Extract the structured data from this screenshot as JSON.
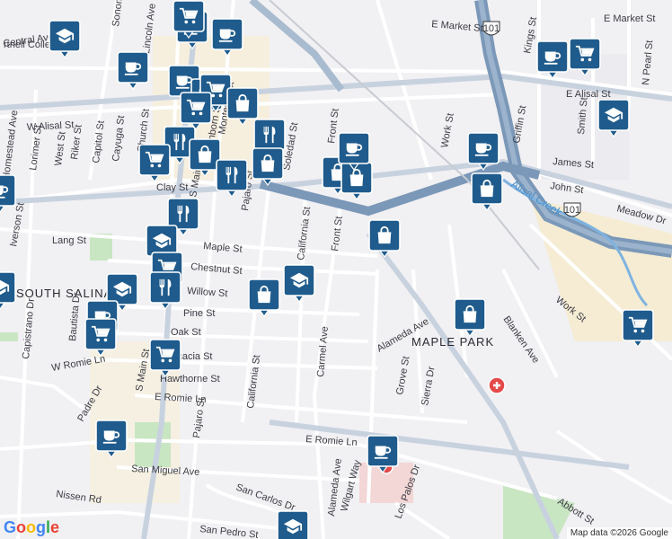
{
  "map": {
    "attribution": "Map data ©2026 Google",
    "logo": "Google",
    "area_labels": [
      {
        "id": "maple-park",
        "text": "MAPLE PARK"
      },
      {
        "id": "south-salinas",
        "text": "SOUTH SALINA"
      },
      {
        "id": "hartnell",
        "text": "rtnell College"
      }
    ],
    "water_labels": [
      {
        "id": "alisal-creek",
        "text": "Alisal Creek"
      }
    ],
    "route_shields": [
      {
        "id": "us101-a",
        "text": "101"
      },
      {
        "id": "us101-b",
        "text": "101"
      }
    ],
    "street_labels": [
      {
        "id": "e-market",
        "text": "E Market St"
      },
      {
        "id": "e-market-2",
        "text": "E Market St"
      },
      {
        "id": "e-alisal",
        "text": "E Alisal St"
      },
      {
        "id": "w-alisal",
        "text": "W Alisal St"
      },
      {
        "id": "central",
        "text": "Central Ave"
      },
      {
        "id": "kings",
        "text": "Kings St"
      },
      {
        "id": "n-pearl",
        "text": "N Pearl St"
      },
      {
        "id": "work-1",
        "text": "Work St"
      },
      {
        "id": "work-2",
        "text": "Work St"
      },
      {
        "id": "griffin",
        "text": "Griffin St"
      },
      {
        "id": "smith",
        "text": "Smith St"
      },
      {
        "id": "james",
        "text": "James St"
      },
      {
        "id": "john",
        "text": "John St"
      },
      {
        "id": "meadow",
        "text": "Meadow Dr"
      },
      {
        "id": "front-1",
        "text": "Front St"
      },
      {
        "id": "front-2",
        "text": "Front St"
      },
      {
        "id": "clay",
        "text": "Clay St"
      },
      {
        "id": "lang",
        "text": "Lang St"
      },
      {
        "id": "iverson",
        "text": "Iverson St"
      },
      {
        "id": "maple",
        "text": "Maple St"
      },
      {
        "id": "chestnut",
        "text": "Chestnut St"
      },
      {
        "id": "willow",
        "text": "Willow St"
      },
      {
        "id": "pine",
        "text": "Pine St"
      },
      {
        "id": "oak",
        "text": "Oak St"
      },
      {
        "id": "acacia",
        "text": "Acacia St"
      },
      {
        "id": "hawthorne",
        "text": "Hawthorne St"
      },
      {
        "id": "e-romie",
        "text": "E Romie Ln"
      },
      {
        "id": "e-romie-2",
        "text": "E Romie Ln"
      },
      {
        "id": "w-romie",
        "text": "W Romie Ln"
      },
      {
        "id": "pajaro-1",
        "text": "Pajaro St"
      },
      {
        "id": "pajaro-2",
        "text": "Pajaro St"
      },
      {
        "id": "california-1",
        "text": "California St"
      },
      {
        "id": "california-2",
        "text": "California St"
      },
      {
        "id": "carmel",
        "text": "Carmel Ave"
      },
      {
        "id": "alameda-1",
        "text": "Alameda Ave"
      },
      {
        "id": "alameda-2",
        "text": "Alameda Ave"
      },
      {
        "id": "grove",
        "text": "Grove St"
      },
      {
        "id": "sierra",
        "text": "Sierra Dr"
      },
      {
        "id": "hawthorne-s",
        "text": "S Main St"
      },
      {
        "id": "abbott",
        "text": "Abbott St"
      },
      {
        "id": "los-palos",
        "text": "Los Palos Dr"
      },
      {
        "id": "wilgart",
        "text": "Wilgart Way"
      },
      {
        "id": "san-miguel",
        "text": "San Miguel Ave"
      },
      {
        "id": "san-carlos",
        "text": "San Carlos Dr"
      },
      {
        "id": "san-pedro",
        "text": "San Pedro St"
      },
      {
        "id": "nissen",
        "text": "Nissen Rd"
      },
      {
        "id": "padre",
        "text": "Padre Dr"
      },
      {
        "id": "capistrano",
        "text": "Capistrano Dr"
      },
      {
        "id": "bautista",
        "text": "Bautista Dr"
      },
      {
        "id": "homestead",
        "text": "Homestead Ave"
      },
      {
        "id": "lorimer",
        "text": "Lorimer St"
      },
      {
        "id": "west",
        "text": "West St"
      },
      {
        "id": "riker",
        "text": "Riker St"
      },
      {
        "id": "capitol",
        "text": "Capitol St"
      },
      {
        "id": "cayuga",
        "text": "Cayuga St"
      },
      {
        "id": "church",
        "text": "Church St"
      },
      {
        "id": "lincoln",
        "text": "Lincoln Ave"
      },
      {
        "id": "soledad",
        "text": "Soledad St"
      },
      {
        "id": "monterey",
        "text": "Monterey St"
      },
      {
        "id": "sanborn",
        "text": "Sanborn St"
      },
      {
        "id": "main-s",
        "text": "S Main St"
      },
      {
        "id": "blanken",
        "text": "Blanken Ave"
      },
      {
        "id": "soledad-top",
        "text": "Sonoma"
      }
    ],
    "pins": [
      {
        "id": "p1",
        "icon": "school-icon"
      },
      {
        "id": "p2",
        "icon": "cafe-icon"
      },
      {
        "id": "p3",
        "icon": "shopping-cart-icon"
      },
      {
        "id": "p4",
        "icon": "cafe-icon"
      },
      {
        "id": "p5",
        "icon": "cafe-icon"
      },
      {
        "id": "p6",
        "icon": "cafe-icon"
      },
      {
        "id": "p7",
        "icon": "cafe-icon"
      },
      {
        "id": "p8",
        "icon": "shopping-cart-icon"
      },
      {
        "id": "p9",
        "icon": "shopping-bag-icon"
      },
      {
        "id": "p10",
        "icon": "restaurant-icon"
      },
      {
        "id": "p11",
        "icon": "shopping-cart-icon"
      },
      {
        "id": "p12",
        "icon": "shopping-bag-icon"
      },
      {
        "id": "p13",
        "icon": "restaurant-icon"
      },
      {
        "id": "p14",
        "icon": "shopping-bag-icon"
      },
      {
        "id": "p15",
        "icon": "restaurant-icon"
      },
      {
        "id": "p16",
        "icon": "shopping-cart-icon"
      },
      {
        "id": "p17",
        "icon": "shopping-bag-icon"
      },
      {
        "id": "p18",
        "icon": "shopping-bag-icon"
      },
      {
        "id": "p19",
        "icon": "cafe-icon"
      },
      {
        "id": "p20",
        "icon": "shopping-bag-icon"
      },
      {
        "id": "p21",
        "icon": "restaurant-icon"
      },
      {
        "id": "p22",
        "icon": "school-icon"
      },
      {
        "id": "p23",
        "icon": "shopping-cart-icon"
      },
      {
        "id": "p24",
        "icon": "school-icon"
      },
      {
        "id": "p25",
        "icon": "restaurant-icon"
      },
      {
        "id": "p26",
        "icon": "shopping-bag-icon"
      },
      {
        "id": "p27",
        "icon": "school-icon"
      },
      {
        "id": "p28",
        "icon": "cafe-icon"
      },
      {
        "id": "p29",
        "icon": "shopping-cart-icon"
      },
      {
        "id": "p30",
        "icon": "shopping-cart-icon"
      },
      {
        "id": "p31",
        "icon": "cafe-icon"
      },
      {
        "id": "p32",
        "icon": "cafe-icon"
      },
      {
        "id": "p33",
        "icon": "school-icon"
      },
      {
        "id": "p34",
        "icon": "cafe-icon"
      },
      {
        "id": "p35",
        "icon": "shopping-cart-icon"
      },
      {
        "id": "p36",
        "icon": "school-icon"
      },
      {
        "id": "p37",
        "icon": "cafe-icon"
      },
      {
        "id": "p38",
        "icon": "shopping-bag-icon"
      },
      {
        "id": "p39",
        "icon": "shopping-bag-icon"
      },
      {
        "id": "p40",
        "icon": "shopping-cart-icon"
      },
      {
        "id": "p41",
        "icon": "cafe-icon"
      },
      {
        "id": "p42",
        "icon": "school-icon"
      }
    ],
    "colors": {
      "pin": "#1f5b8c",
      "freeway": "#7b98b8",
      "water": "#4a8fc8",
      "park": "#c9e6c2",
      "hospital": "#e44a4a",
      "land": "#f1f0f3",
      "area": "#f7efd8"
    }
  }
}
